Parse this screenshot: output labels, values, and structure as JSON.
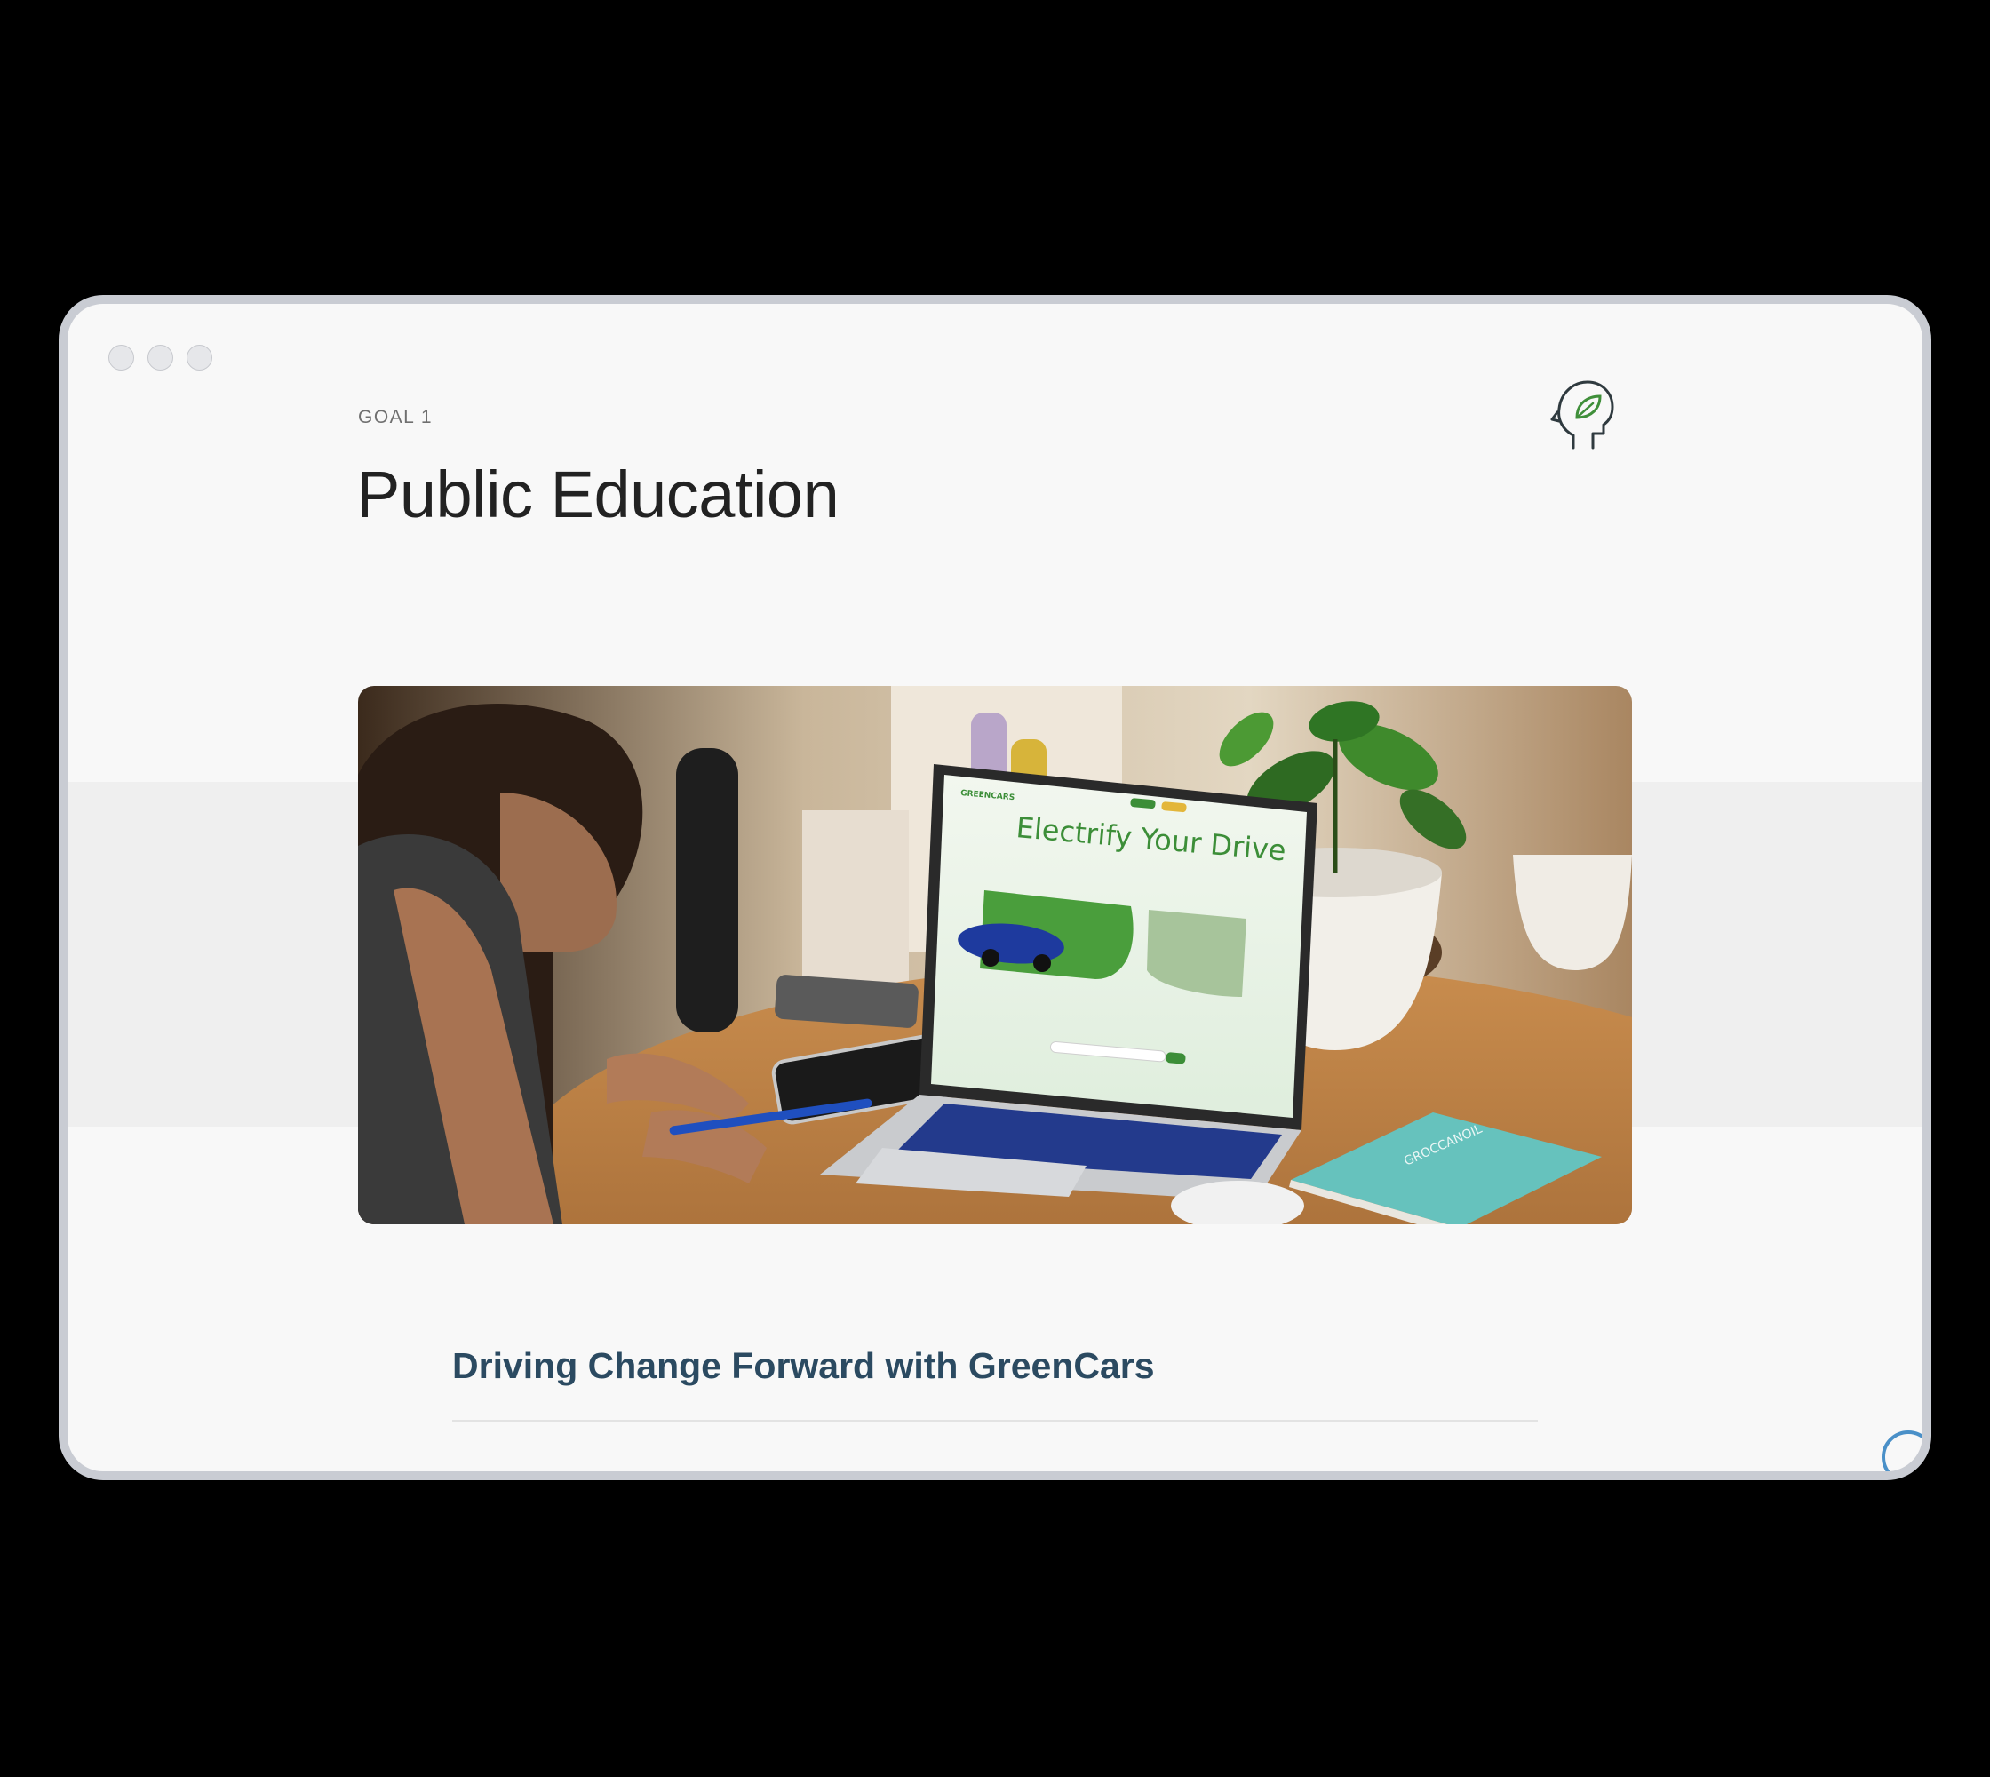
{
  "window": {
    "controls": [
      "window-dot",
      "window-dot",
      "window-dot"
    ]
  },
  "goal": {
    "eyebrow": "GOAL 1",
    "title": "Public Education",
    "icon": "head-leaf-icon"
  },
  "hero": {
    "screen_headline": "Electrify Your Drive",
    "screen_brand": "GREENCARS",
    "notebook_text": "GROCCANOIL"
  },
  "section": {
    "heading": "Driving Change Forward with GreenCars"
  },
  "colors": {
    "heading": "#2b4a61",
    "accent_green": "#3f8f3a",
    "page_bg": "#f8f8f8",
    "frame": "#c9ccd3"
  }
}
